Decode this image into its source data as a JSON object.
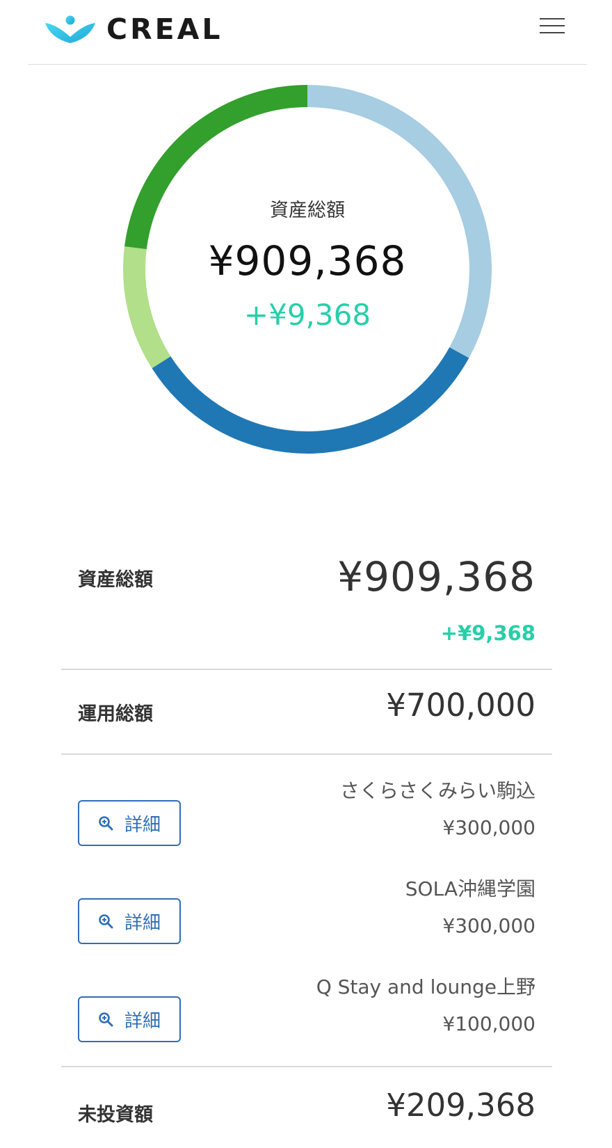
{
  "header": {
    "logo_text": "CREAL",
    "menu_icon": "hamburger-menu-icon"
  },
  "colors": {
    "brand_cyan": "#2ec7e8",
    "gain_green": "#26cfa9",
    "button_blue": "#2d6fb6"
  },
  "chart_data": {
    "type": "pie",
    "style": "donut",
    "slices": [
      {
        "value": 300000,
        "color": "#a6cde2"
      },
      {
        "value": 300000,
        "color": "#1f78b4"
      },
      {
        "value": 100000,
        "color": "#b1df8a"
      },
      {
        "value": 209368,
        "color": "#339f2c"
      }
    ],
    "center": {
      "label": "資産総額",
      "total": "¥909,368",
      "gain": "+¥9,368"
    }
  },
  "summary": {
    "total": {
      "label": "資産総額",
      "value": "¥909,368",
      "gain": "+¥9,368"
    },
    "invested": {
      "label": "運用総額",
      "value": "¥700,000"
    },
    "projects": [
      {
        "button_label": "詳細",
        "button_icon": "zoom-in-icon",
        "name": "さくらさくみらい駒込",
        "amount": "¥300,000"
      },
      {
        "button_label": "詳細",
        "button_icon": "zoom-in-icon",
        "name": "SOLA沖縄学園",
        "amount": "¥300,000"
      },
      {
        "button_label": "詳細",
        "button_icon": "zoom-in-icon",
        "name": "Q Stay and lounge上野",
        "amount": "¥100,000"
      }
    ],
    "uninvested": {
      "label": "未投資額",
      "value": "¥209,368"
    }
  }
}
